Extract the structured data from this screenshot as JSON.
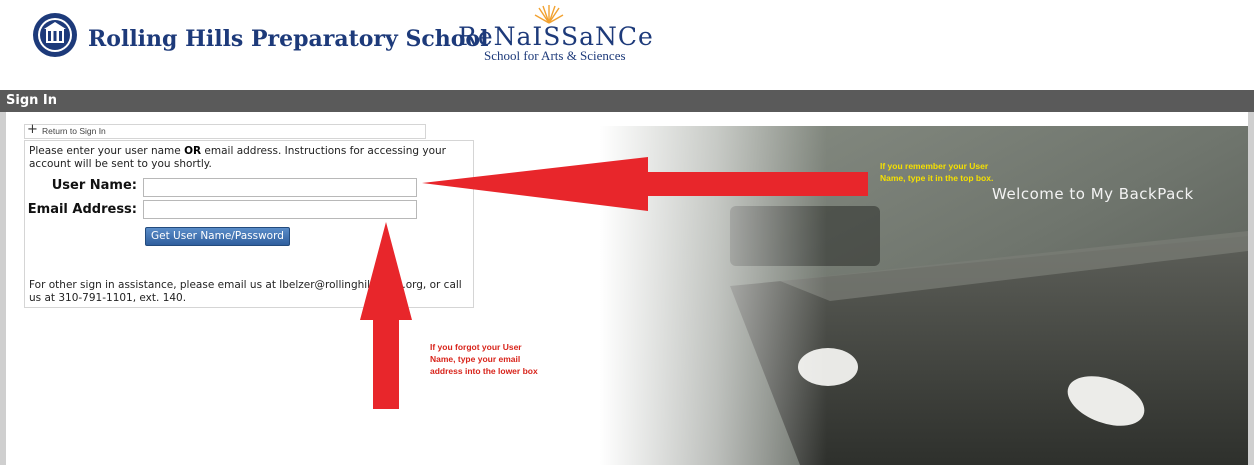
{
  "header": {
    "school_name": "Rolling Hills Preparatory School",
    "partner_name": "ReNaISSaNCe",
    "partner_subtitle": "School for Arts & Sciences"
  },
  "titlebar": {
    "title": "Sign In"
  },
  "return_link": {
    "icon": "plus-icon",
    "label": "Return to Sign In"
  },
  "form": {
    "intro_before": "Please enter your user name ",
    "intro_bold": "OR",
    "intro_after": " email address. Instructions for accessing your account will be sent to you shortly.",
    "user_label": "User Name:",
    "user_value": "",
    "email_label": "Email Address:",
    "email_value": "",
    "submit_label": "Get User Name/Password",
    "assistance": "For other sign in assistance, please email us at lbelzer@rollinghillsprep.org, or call us at 310-791-1101, ext. 140."
  },
  "annotations": {
    "right_note": "If you remember your User Name, type it in the top box.",
    "bottom_note": "If you forgot your User Name, type your email address into the lower box",
    "arrow_color": "#e8262b"
  },
  "background": {
    "welcome_text": "Welcome to My BackPack"
  },
  "colors": {
    "brand_navy": "#1d3a7a",
    "title_bar": "#5a5a5a",
    "button_blue": "#2f5f9e"
  }
}
